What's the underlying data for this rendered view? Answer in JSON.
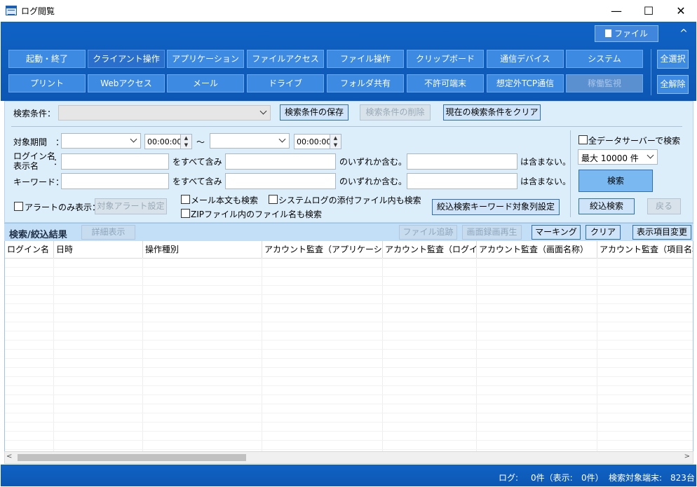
{
  "window": {
    "title": "ログ閲覧",
    "minimize": "—",
    "maximize": "☐",
    "close": "✕"
  },
  "header": {
    "file_menu": "ファイル",
    "collapse": "^",
    "categories_row1": [
      "起動・終了",
      "クライアント操作",
      "アプリケーション",
      "ファイルアクセス",
      "ファイル操作",
      "クリップボード",
      "通信デバイス",
      "システム"
    ],
    "categories_row2": [
      "プリント",
      "Webアクセス",
      "メール",
      "ドライブ",
      "フォルダ共有",
      "不許可端末",
      "想定外TCP通信",
      "稼働監視"
    ],
    "select_all": "全選択",
    "clear_all": "全解除"
  },
  "search": {
    "condition_label": "検索条件：",
    "condition_value": "",
    "save_condition": "検索条件の保存",
    "delete_condition": "検索条件の削除",
    "clear_condition": "現在の検索条件をクリア",
    "period_label": "対象期間　：",
    "time_from": "00:00:00",
    "tilde": "～",
    "time_to": "00:00:00",
    "login_label_1": "ログイン名",
    "login_label_2": "表示名",
    "login_colon": "：",
    "keyword_label": "キーワード：",
    "contains_all": "をすべて含み",
    "contains_any": "のいずれか含む。",
    "not_contains": "は含まない。",
    "alert_only": "アラートのみ表示：",
    "alert_settings": "対象アラート設定",
    "mail_body": "メール本文も検索",
    "syslog_attach": "システムログの添付ファイル内も検索",
    "zip_names": "ZIPファイル内のファイル名も検索",
    "keyword_columns": "絞込検索キーワード対象列設定",
    "all_servers": "全データサーバーで検索",
    "max_results": "最大 10000 件",
    "search_button": "検索",
    "refine_button": "絞込検索",
    "back_button": "戻る"
  },
  "results": {
    "title": "検索/絞込結果",
    "detail": "詳細表示",
    "file_trace": "ファイル追跡",
    "screen_replay": "画面録画再生",
    "marking": "マーキング",
    "clear": "クリア",
    "columns_change": "表示項目変更",
    "columns": [
      "ログイン名",
      "日時",
      "操作種別",
      "アカウント監査（アプリケーショ...",
      "アカウント監査（ログイン...",
      "アカウント監査（画面名称）",
      "アカウント監査（項目名称"
    ]
  },
  "status": {
    "log_label": "ログ:",
    "log_count": "0件（表示:",
    "shown_count": "0件）",
    "targets_label": "検索対象端末:",
    "targets_count": "823台"
  }
}
